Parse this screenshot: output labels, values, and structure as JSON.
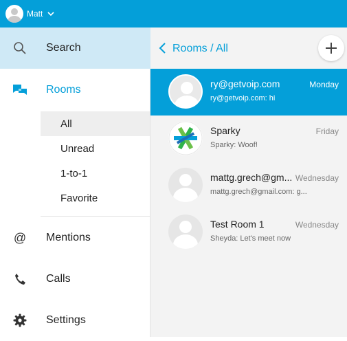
{
  "colors": {
    "accent": "#049fd9",
    "selected_bg": "#cfe9f6",
    "sub_selected_bg": "#eeeeee",
    "main_bg": "#f3f3f3"
  },
  "topbar": {
    "username": "Matt",
    "avatar_icon": "user-avatar-icon",
    "menu_icon": "chevron-down-icon"
  },
  "sidebar": {
    "search": {
      "label": "Search",
      "icon": "search-icon"
    },
    "rooms": {
      "label": "Rooms",
      "icon": "chat-bubbles-icon"
    },
    "filters": [
      {
        "label": "All"
      },
      {
        "label": "Unread"
      },
      {
        "label": "1-to-1"
      },
      {
        "label": "Favorite"
      }
    ],
    "mentions": {
      "label": "Mentions",
      "icon": "at-icon"
    },
    "calls": {
      "label": "Calls",
      "icon": "phone-icon"
    },
    "settings": {
      "label": "Settings",
      "icon": "gear-icon"
    }
  },
  "main": {
    "breadcrumb": "Rooms / All",
    "back_icon": "chevron-left-icon",
    "add_icon": "plus-icon",
    "rooms": [
      {
        "name": "ry@getvoip.com",
        "time": "Monday",
        "preview": "ry@getvoip.com: hi",
        "active": true
      },
      {
        "name": "Sparky",
        "time": "Friday",
        "preview": "Sparky: Woof!",
        "active": false
      },
      {
        "name": "mattg.grech@gm...",
        "time": "Wednesday",
        "preview": "mattg.grech@gmail.com: g...",
        "active": false
      },
      {
        "name": "Test Room 1",
        "time": "Wednesday",
        "preview": "Sheyda: Let's meet now",
        "active": false
      }
    ]
  }
}
